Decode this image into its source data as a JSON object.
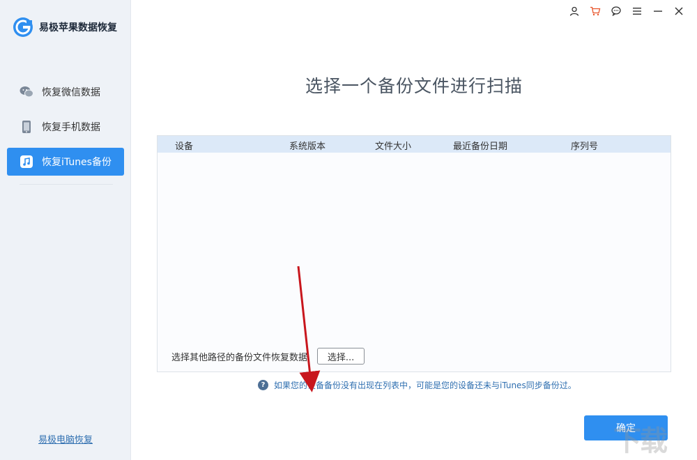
{
  "app": {
    "title": "易极苹果数据恢复"
  },
  "sidebar": {
    "items": [
      {
        "label": "恢复微信数据",
        "icon": "wechat-icon",
        "active": false
      },
      {
        "label": "恢复手机数据",
        "icon": "phone-icon",
        "active": false
      },
      {
        "label": "恢复iTunes备份",
        "icon": "itunes-icon",
        "active": true
      }
    ],
    "footer_link": "易极电脑恢复"
  },
  "window_controls": [
    "user-icon",
    "cart-icon",
    "feedback-icon",
    "menu-icon",
    "minimize-icon",
    "close-icon"
  ],
  "main": {
    "title": "选择一个备份文件进行扫描",
    "table": {
      "columns": [
        "设备",
        "系统版本",
        "文件大小",
        "最近备份日期",
        "序列号"
      ],
      "rows": []
    },
    "other_path_label": "选择其他路径的备份文件恢复数据",
    "choose_button": "选择...",
    "hint_icon": "?",
    "hint_text": "如果您的设备备份没有出现在列表中，可能是您的设备还未与iTunes同步备份过。",
    "confirm_button": "确定"
  },
  "colors": {
    "accent": "#2f8ff0",
    "sidebar_bg": "#eef2f7",
    "table_header_bg": "#dce9f8",
    "link": "#2f6fb0",
    "annotation_arrow": "#c8161d"
  },
  "watermark": "下载"
}
